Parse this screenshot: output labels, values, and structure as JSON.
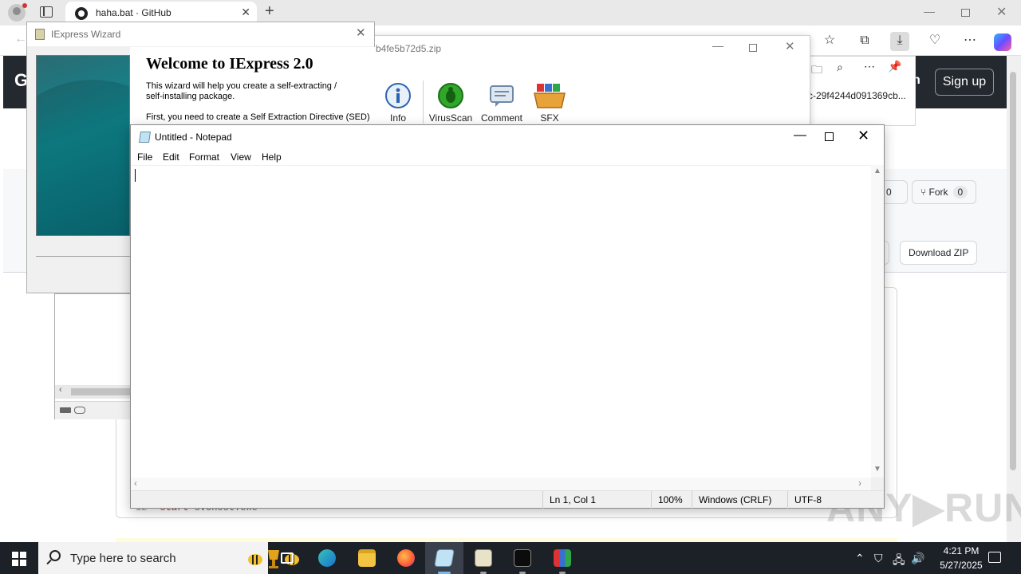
{
  "browser": {
    "tab_title": "haha.bat · GitHub",
    "tab_close": "✕",
    "new_tab": "+",
    "window_min": "—",
    "window_close": "✕"
  },
  "github": {
    "logo": "G",
    "signin": "n",
    "signup": "Sign up",
    "star_count": "0",
    "fork_label": "Fork",
    "fork_count": "0",
    "download_zip": "Download ZIP",
    "code_line_number": "12",
    "code_keyword": "start",
    "code_rest": " svchost.exe",
    "watermark": "ANY▶RUN"
  },
  "winrar": {
    "title": "b4fe5b72d5.zip",
    "tools": [
      {
        "label": "Info",
        "icon": "info-icon"
      },
      {
        "label": "VirusScan",
        "icon": "virus-scan-icon"
      },
      {
        "label": "Comment",
        "icon": "comment-icon"
      },
      {
        "label": "SFX",
        "icon": "sfx-icon"
      }
    ]
  },
  "downloads": {
    "file_name": "c-29f4244d091369cb..."
  },
  "iexpress": {
    "title": "IExpress Wizard",
    "heading": "Welcome to IExpress 2.0",
    "para1": "This wizard will help you create a self-extracting / self-installing package.",
    "para2": "First, you need to create a Self Extraction Directive (SED)"
  },
  "notepad": {
    "title": "Untitled - Notepad",
    "menu": [
      "File",
      "Edit",
      "Format",
      "View",
      "Help"
    ],
    "content": "",
    "status": {
      "position": "Ln 1, Col 1",
      "zoom": "100%",
      "line_ending": "Windows (CRLF)",
      "encoding": "UTF-8"
    }
  },
  "taskbar": {
    "search_placeholder": "Type here to search",
    "time": "4:21 PM",
    "date": "5/27/2025",
    "apps": [
      "task-view",
      "edge",
      "file-explorer",
      "firefox",
      "notepad",
      "archive",
      "terminal",
      "winrar"
    ]
  }
}
